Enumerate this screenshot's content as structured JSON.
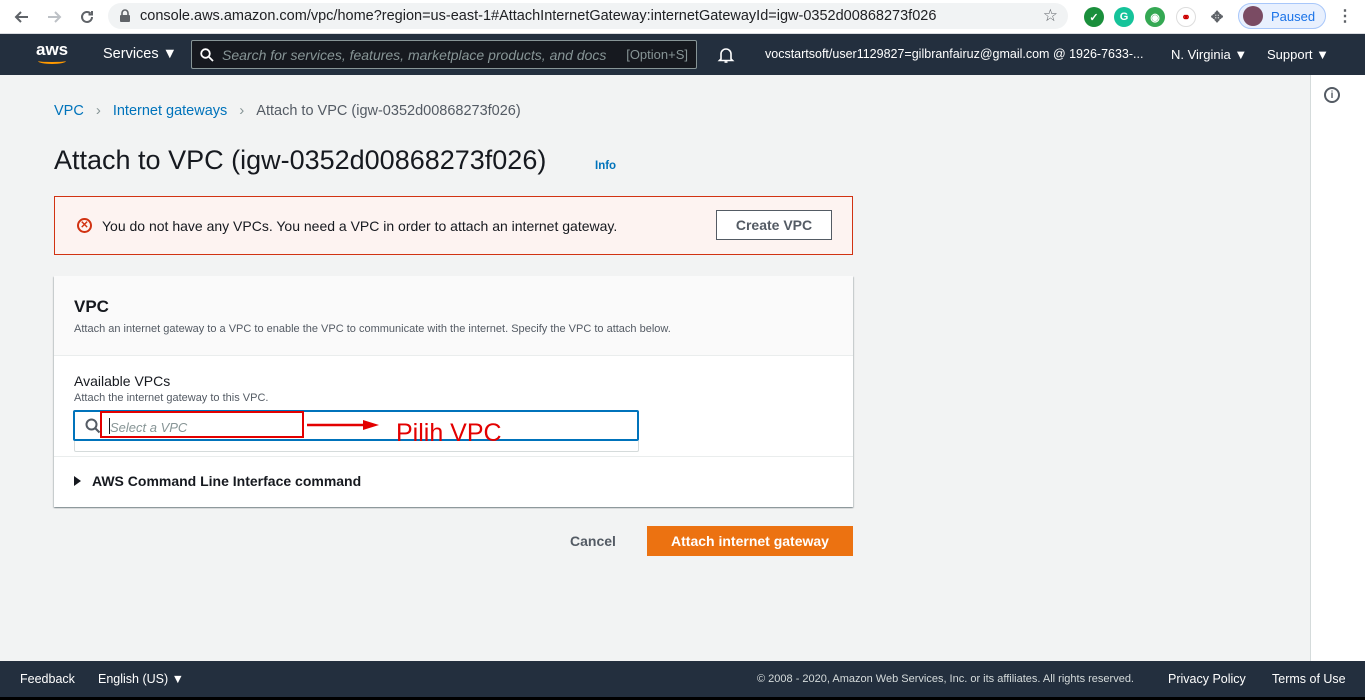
{
  "browser": {
    "url": "console.aws.amazon.com/vpc/home?region=us-east-1#AttachInternetGateway:internetGatewayId=igw-0352d00868273f026",
    "profile_status": "Paused"
  },
  "nav": {
    "services_label": "Services ▼",
    "search_placeholder": "Search for services, features, marketplace products, and docs",
    "search_shortcut": "[Option+S]",
    "account": "vocstartsoft/user1129827=gilbranfairuz@gmail.com @ 1926-7633-...",
    "region": "N. Virginia ▼",
    "support": "Support ▼"
  },
  "breadcrumb": {
    "items": [
      "VPC",
      "Internet gateways",
      "Attach to VPC (igw-0352d00868273f026)"
    ]
  },
  "page": {
    "title": "Attach to VPC (igw-0352d00868273f026)",
    "info_link": "Info"
  },
  "alert": {
    "message": "You do not have any VPCs. You need a VPC in order to attach an internet gateway.",
    "button": "Create VPC"
  },
  "panel": {
    "heading": "VPC",
    "description": "Attach an internet gateway to a VPC to enable the VPC to communicate with the internet. Specify the VPC to attach below.",
    "field_label": "Available VPCs",
    "field_description": "Attach the internet gateway to this VPC.",
    "field_placeholder": "Select a VPC",
    "cli_label": "AWS Command Line Interface command"
  },
  "annotation": {
    "text": "Pilih VPC"
  },
  "actions": {
    "cancel": "Cancel",
    "attach": "Attach internet gateway"
  },
  "footer": {
    "feedback": "Feedback",
    "language": "English (US) ▼",
    "copyright": "© 2008 - 2020, Amazon Web Services, Inc. or its affiliates. All rights reserved.",
    "privacy": "Privacy Policy",
    "terms": "Terms of Use"
  },
  "colors": {
    "aws_nav": "#232f3e",
    "link": "#0073bb",
    "primary_button": "#ec7211",
    "error": "#d13212",
    "annotation": "#e30000"
  }
}
